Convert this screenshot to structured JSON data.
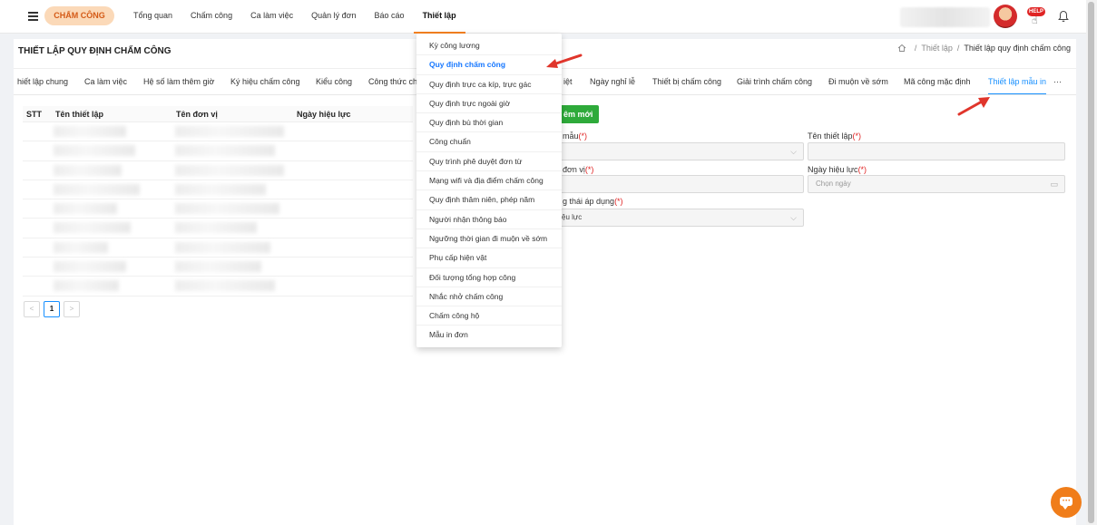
{
  "header": {
    "app_name": "CHẤM CÔNG",
    "nav": [
      "Tổng quan",
      "Chấm công",
      "Ca làm việc",
      "Quản lý đơn",
      "Báo cáo",
      "Thiết lập"
    ],
    "help_badge": "HELP"
  },
  "page": {
    "title": "THIẾT LẬP QUY ĐỊNH CHẤM CÔNG",
    "breadcrumb": [
      "Thiết lập",
      "Thiết lập quy định chấm công"
    ],
    "breadcrumb_sep": "/"
  },
  "tabs": [
    "hiết lập chung",
    "Ca làm việc",
    "Hệ số làm thêm giờ",
    "Ký hiệu chấm công",
    "Kiểu công",
    "Công thức ch",
    "iệt",
    "Ngày nghỉ lễ",
    "Thiết bị chấm công",
    "Giải trình chấm công",
    "Đi muộn về sớm",
    "Mã công mặc định",
    "Thiết lập mẫu in",
    "···"
  ],
  "table": {
    "columns": [
      "STT",
      "Tên thiết lập",
      "Tên đơn vị",
      "Ngày hiệu lực"
    ],
    "row_count": 9
  },
  "pagination": {
    "prev": "<",
    "current": "1",
    "next": ">"
  },
  "form": {
    "add_button": "êm mới",
    "fields": {
      "mau": {
        "label": "mẫu",
        "required": "(*)"
      },
      "ten_thiet_lap": {
        "label": "Tên thiết lập",
        "required": "(*)"
      },
      "don_vi": {
        "label": "đơn vị",
        "required": "(*)"
      },
      "ngay_hieu_luc": {
        "label": "Ngày hiệu lực",
        "required": "(*)",
        "placeholder": "Chọn ngày"
      },
      "trang_thai": {
        "label": "g thái áp dụng",
        "required": "(*)",
        "value": "ệu lực"
      }
    }
  },
  "dropdown": {
    "items": [
      "Kỳ công lương",
      "Quy định chấm công",
      "Quy định trực ca kíp, trực gác",
      "Quy định trực ngoài giờ",
      "Quy định bù thời gian",
      "Công chuẩn",
      "Quy trình phê duyệt đơn từ",
      "Mạng wifi và địa điểm chấm công",
      "Quy định thâm niên, phép năm",
      "Người nhận thông báo",
      "Ngưỡng thời gian đi muộn về sớm",
      "Phụ cấp hiện vật",
      "Đối tượng tổng hợp công",
      "Nhắc nhở chấm công",
      "Chấm công hộ",
      "Mẫu in đơn"
    ],
    "active_index": 1
  },
  "colors": {
    "accent": "#f58220",
    "active_tab": "#1890ff",
    "add_button": "#2eaa3a",
    "annotation_arrow": "#e0352b",
    "required": "#e02424"
  }
}
